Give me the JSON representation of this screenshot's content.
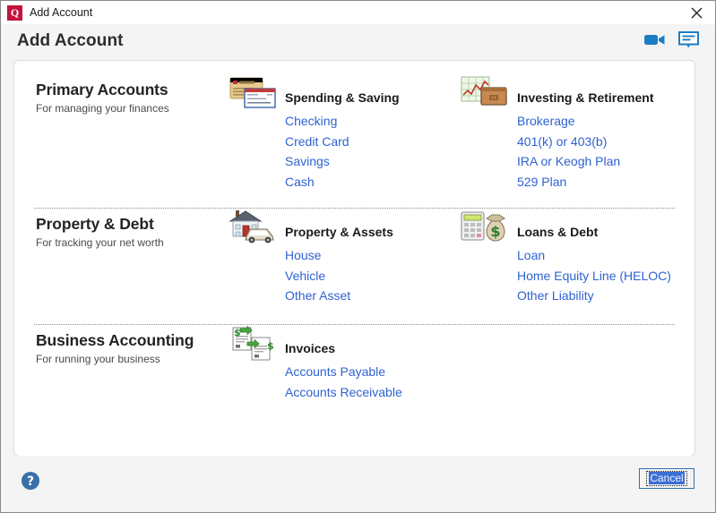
{
  "window": {
    "title": "Add Account",
    "logo_text": "Q",
    "logo_color": "#c4123f",
    "close_icon": "close-icon"
  },
  "header": {
    "title": "Add Account",
    "icons": [
      {
        "name": "video-icon",
        "color": "#1b7dc4"
      },
      {
        "name": "chat-bubble-icon",
        "color": "#1b7dc4"
      }
    ]
  },
  "theme": {
    "link_color": "#2f62d0",
    "accent_blue": "#1b7dc4",
    "card_background": "#ffffff",
    "dialog_background": "#f4f4f4"
  },
  "sections": [
    {
      "title": "Primary Accounts",
      "subtitle": "For managing your finances",
      "groups": [
        {
          "icon": "credit-card-and-check-icon",
          "title": "Spending & Saving",
          "links": [
            "Checking",
            "Credit Card",
            "Savings",
            "Cash"
          ]
        },
        {
          "icon": "chart-and-briefcase-icon",
          "title": "Investing & Retirement",
          "links": [
            "Brokerage",
            "401(k) or 403(b)",
            "IRA or Keogh Plan",
            "529 Plan"
          ]
        }
      ]
    },
    {
      "title": "Property & Debt",
      "subtitle": "For tracking your net worth",
      "groups": [
        {
          "icon": "house-and-car-icon",
          "title": "Property & Assets",
          "links": [
            "House",
            "Vehicle",
            "Other Asset"
          ]
        },
        {
          "icon": "calculator-and-money-bag-icon",
          "title": "Loans & Debt",
          "links": [
            "Loan",
            "Home Equity Line (HELOC)",
            "Other Liability"
          ]
        }
      ]
    },
    {
      "title": "Business Accounting",
      "subtitle": "For running your business",
      "groups": [
        {
          "icon": "invoice-documents-icon",
          "title": "Invoices",
          "links": [
            "Accounts Payable",
            "Accounts Receivable"
          ]
        }
      ]
    }
  ],
  "footer": {
    "help_icon": "help-question-icon",
    "cancel_label": "Cancel"
  }
}
